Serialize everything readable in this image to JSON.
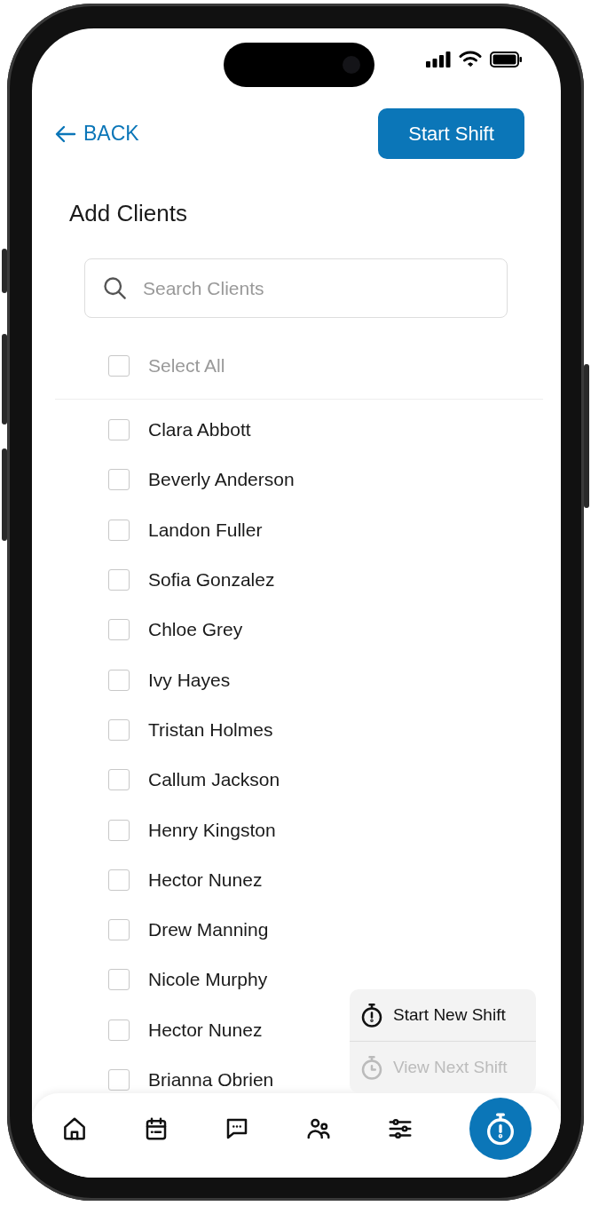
{
  "header": {
    "back_label": "BACK",
    "action_label": "Start Shift"
  },
  "title": "Add Clients",
  "search": {
    "placeholder": "Search Clients"
  },
  "select_all": {
    "label": "Select All",
    "checked": false
  },
  "clients": [
    {
      "name": "Clara Abbott",
      "checked": false
    },
    {
      "name": "Beverly Anderson",
      "checked": false
    },
    {
      "name": "Landon Fuller",
      "checked": false
    },
    {
      "name": "Sofia Gonzalez",
      "checked": false
    },
    {
      "name": "Chloe Grey",
      "checked": false
    },
    {
      "name": "Ivy Hayes",
      "checked": false
    },
    {
      "name": "Tristan Holmes",
      "checked": false
    },
    {
      "name": "Callum Jackson",
      "checked": false
    },
    {
      "name": "Henry Kingston",
      "checked": false
    },
    {
      "name": "Hector Nunez",
      "checked": false
    },
    {
      "name": "Drew Manning",
      "checked": false
    },
    {
      "name": "Nicole Murphy",
      "checked": false
    },
    {
      "name": "Hector Nunez",
      "checked": false
    },
    {
      "name": "Brianna Obrien",
      "checked": false
    }
  ],
  "shift_menu": [
    {
      "label": "Start New Shift",
      "kind": "alert",
      "disabled": false
    },
    {
      "label": "View Next Shift",
      "kind": "clock",
      "disabled": true
    }
  ],
  "nav": [
    {
      "kind": "home"
    },
    {
      "kind": "calendar"
    },
    {
      "kind": "chat"
    },
    {
      "kind": "people"
    },
    {
      "kind": "sliders"
    },
    {
      "kind": "timer"
    }
  ]
}
